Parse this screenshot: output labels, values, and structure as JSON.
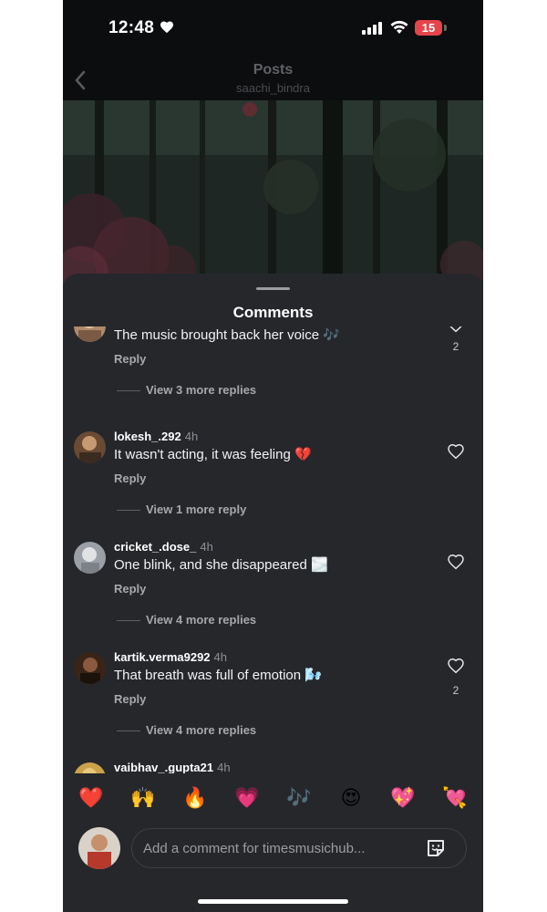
{
  "status_bar": {
    "time": "12:48",
    "battery": "15"
  },
  "header": {
    "title": "Posts",
    "username": "saachi_bindra"
  },
  "sheet": {
    "title": "Comments"
  },
  "comments": [
    {
      "username": "",
      "ago": "",
      "text": "The music brought back her voice 🎶",
      "reply_label": "Reply",
      "likes": "2",
      "more_replies": "View 3 more replies"
    },
    {
      "username": "lokesh_.292",
      "ago": "4h",
      "text": "It wasn't acting, it was feeling 💔",
      "reply_label": "Reply",
      "likes": "",
      "more_replies": "View 1 more reply"
    },
    {
      "username": "cricket_.dose_",
      "ago": "4h",
      "text": "One blink, and she disappeared 🌫️",
      "reply_label": "Reply",
      "likes": "",
      "more_replies": "View 4 more replies"
    },
    {
      "username": "kartik.verma9292",
      "ago": "4h",
      "text": "That breath was full of emotion 🌬️",
      "reply_label": "Reply",
      "likes": "2",
      "more_replies": "View 4 more replies"
    },
    {
      "username": "vaibhav_.gupta21",
      "ago": "4h",
      "text": "",
      "reply_label": "",
      "likes": "",
      "more_replies": ""
    }
  ],
  "emoji_reactions": [
    "❤️",
    "🙌",
    "🔥",
    "💗",
    "🎶",
    "😍",
    "💖",
    "💘"
  ],
  "composer": {
    "placeholder": "Add a comment for timesmusichub..."
  },
  "colors": {
    "background": "#0c0d0f",
    "sheet": "#25272b",
    "battery_red": "#e5454a"
  },
  "icons": [
    "heart-icon",
    "signal-icon",
    "wifi-icon",
    "battery-icon",
    "back-chevron-icon",
    "like-heart-icon",
    "sticker-icon"
  ]
}
